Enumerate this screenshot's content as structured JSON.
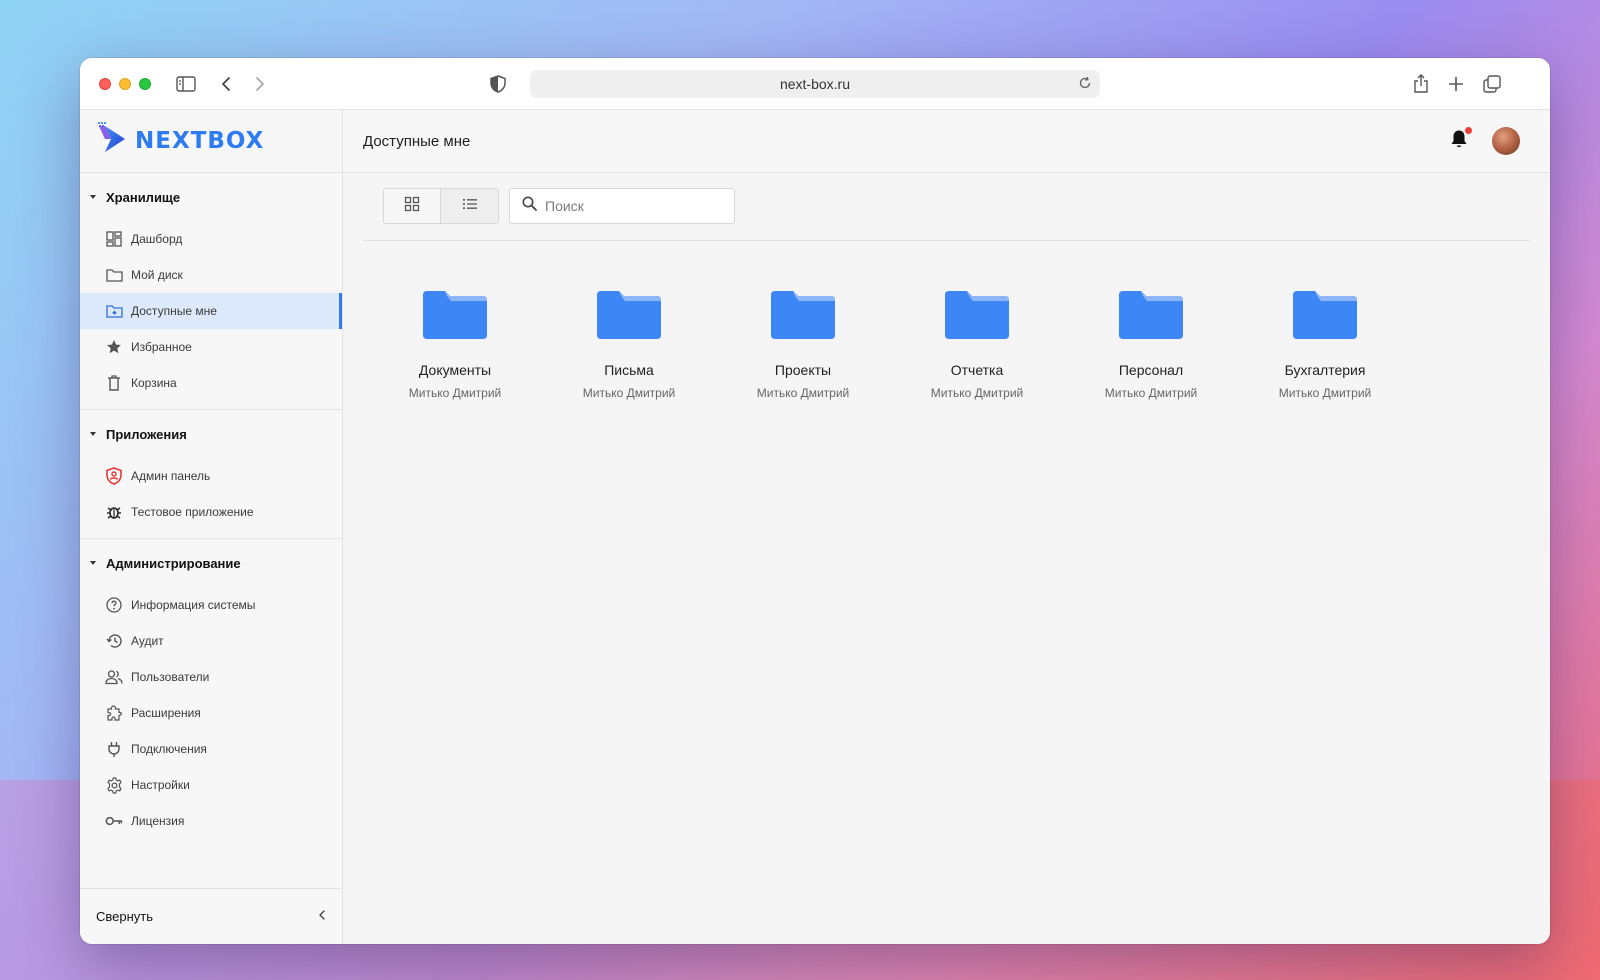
{
  "browser": {
    "url": "next-box.ru"
  },
  "brand": {
    "name": "NEXTBOX",
    "color": "#2f7bf2"
  },
  "sidebar": {
    "sections": [
      {
        "title": "Хранилище",
        "items": [
          {
            "label": "Дашборд",
            "icon": "dashboard-icon"
          },
          {
            "label": "Мой диск",
            "icon": "folder-icon"
          },
          {
            "label": "Доступные мне",
            "icon": "shared-folder-icon",
            "active": true
          },
          {
            "label": "Избранное",
            "icon": "star-icon"
          },
          {
            "label": "Корзина",
            "icon": "trash-icon"
          }
        ]
      },
      {
        "title": "Приложения",
        "items": [
          {
            "label": "Админ панель",
            "icon": "admin-shield-icon"
          },
          {
            "label": "Тестовое приложение",
            "icon": "bug-icon"
          }
        ]
      },
      {
        "title": "Администрирование",
        "items": [
          {
            "label": "Информация системы",
            "icon": "help-circle-icon"
          },
          {
            "label": "Аудит",
            "icon": "history-icon"
          },
          {
            "label": "Пользователи",
            "icon": "users-icon"
          },
          {
            "label": "Расширения",
            "icon": "puzzle-icon"
          },
          {
            "label": "Подключения",
            "icon": "plug-icon"
          },
          {
            "label": "Настройки",
            "icon": "gear-icon"
          },
          {
            "label": "Лицензия",
            "icon": "key-icon"
          }
        ]
      }
    ],
    "collapse_label": "Свернуть"
  },
  "header": {
    "title": "Доступные мне",
    "notification_dot_color": "#ef3e36"
  },
  "toolbar": {
    "search_placeholder": "Поиск",
    "view_mode": "grid"
  },
  "folders": [
    {
      "name": "Документы",
      "owner": "Митько Дмитрий"
    },
    {
      "name": "Письма",
      "owner": "Митько Дмитрий"
    },
    {
      "name": "Проекты",
      "owner": "Митько Дмитрий"
    },
    {
      "name": "Отчетка",
      "owner": "Митько Дмитрий"
    },
    {
      "name": "Персонал",
      "owner": "Митько Дмитрий"
    },
    {
      "name": "Бухгалтерия",
      "owner": "Митько Дмитрий"
    }
  ],
  "colors": {
    "accent": "#2f7bf2",
    "folder": "#3d86f5",
    "folder_tab": "#8db5f7",
    "active_bg": "#dbe9fb"
  }
}
